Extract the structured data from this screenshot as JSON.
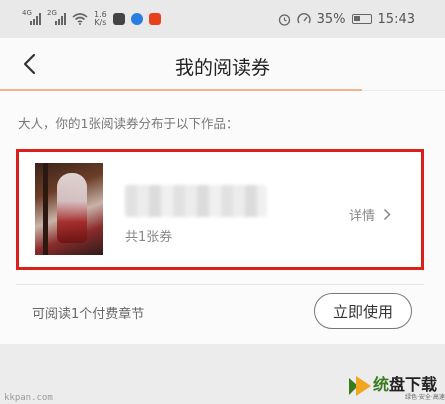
{
  "status_bar": {
    "net1": "4G",
    "net2": "2G",
    "speed_value": "1.6",
    "speed_unit": "K/s",
    "battery": "35%",
    "time": "15:43",
    "brand_color": "#e8401b"
  },
  "header": {
    "title": "我的阅读券",
    "accent_color": "#f0b48a"
  },
  "main": {
    "intro": "大人，你的1张阅读券分布于以下作品：",
    "book": {
      "count": "共1张券",
      "details_label": "详情",
      "highlight_color": "#d9201b"
    },
    "footer_text": "可阅读1个付费章节",
    "use_button": "立即使用"
  },
  "watermarks": {
    "left": "kkpan.com",
    "brand_a": "统",
    "brand_b": "盘下载",
    "brand_sub": "绿色·安全·高速"
  }
}
